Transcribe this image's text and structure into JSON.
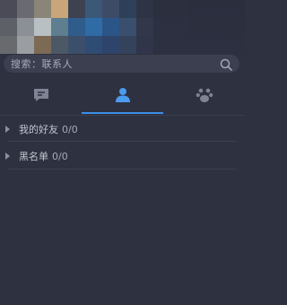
{
  "search": {
    "placeholder": "搜索：联系人"
  },
  "tabs": [
    {
      "name": "messages",
      "icon": "chat-icon",
      "active": false
    },
    {
      "name": "contacts",
      "icon": "contact-icon",
      "active": true
    },
    {
      "name": "groups",
      "icon": "paw-icon",
      "active": false
    }
  ],
  "groups": [
    {
      "name": "我的好友",
      "count": "0/0"
    },
    {
      "name": "黑名单",
      "count": "0/0"
    }
  ],
  "colors": {
    "background": "#2e3140",
    "accent": "#3d8fe6",
    "search_bg": "#3b3f4f"
  },
  "mosaic": [
    "#4a4b56",
    "#6a6a72",
    "#8a8577",
    "#c9a679",
    "#3d4150",
    "#3b5878",
    "#3d4b66",
    "#2e3f59",
    "#2f3346",
    "#2b2f3e",
    "#2b2f3e",
    "#5e6068",
    "#8b8f96",
    "#b8c0c4",
    "#5f7e8f",
    "#2f5c8a",
    "#2f6ca6",
    "#2a5586",
    "#3a4e6d",
    "#32374a",
    "#2c3040",
    "#2c3040",
    "#686a6e",
    "#9a9ea2",
    "#7d6a55",
    "#4d5866",
    "#3b4f6b",
    "#2f4c74",
    "#2e446a",
    "#34425c",
    "#30354a",
    "#2c3040",
    "#2c3040"
  ]
}
